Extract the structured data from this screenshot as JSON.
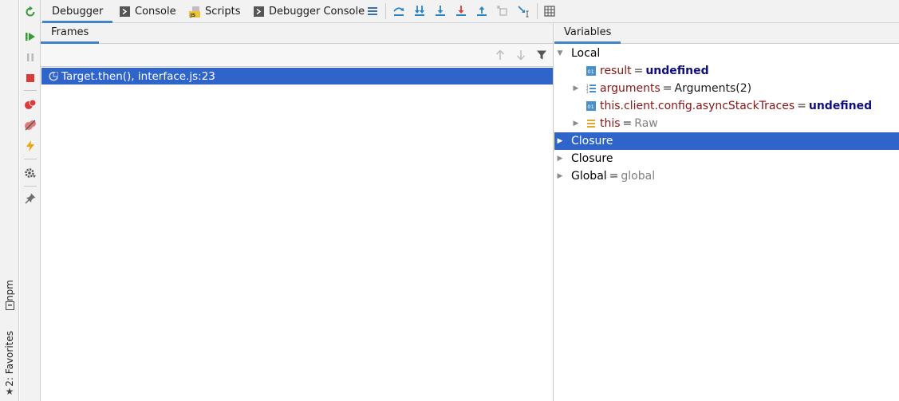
{
  "toolbar": {
    "tabs": [
      {
        "label": "Debugger",
        "active": true
      },
      {
        "label": "Console",
        "icon": "console-icon"
      },
      {
        "label": "Scripts",
        "icon": "js-script-icon"
      },
      {
        "label": "Debugger Console",
        "icon": "console-icon"
      }
    ],
    "action_icons": [
      "layout-menu-icon",
      "step-over-icon",
      "force-step-into-icon",
      "step-into-icon",
      "force-step-into-red-icon",
      "step-out-icon",
      "drop-frame-icon",
      "run-to-cursor-icon",
      "evaluate-expression-icon"
    ]
  },
  "left_actions": [
    "rerun-icon",
    "resume-icon",
    "pause-icon",
    "stop-icon",
    "view-breakpoints-icon",
    "mute-breakpoints-icon",
    "lightning-icon",
    "settings-icon",
    "pin-icon"
  ],
  "side_stripe": {
    "npm_label": "npm",
    "favorites_label": "2: Favorites"
  },
  "frames": {
    "title": "Frames",
    "items": [
      {
        "label": "Target.then(), interface.js:23",
        "selected": true
      }
    ]
  },
  "variables": {
    "title": "Variables",
    "local_label": "Local",
    "items": [
      {
        "name": "result",
        "eq": "=",
        "value": "undefined",
        "icon": "primitive-icon"
      },
      {
        "name": "arguments",
        "eq": "=",
        "value": "Arguments(2)",
        "icon": "array-icon"
      },
      {
        "name": "this.client.config.asyncStackTraces",
        "eq": "=",
        "value": "undefined",
        "icon": "primitive-icon"
      },
      {
        "name": "this",
        "eq": "=",
        "value": "Raw",
        "icon": "object-icon"
      }
    ],
    "scopes": [
      {
        "label": "Closure",
        "selected": true
      },
      {
        "label": "Closure"
      },
      {
        "label": "Global",
        "eq": "=",
        "value": "global"
      }
    ]
  },
  "colors": {
    "selection": "#2f65ca",
    "accent": "#4083c9",
    "var_name": "#8b1313",
    "keyword": "#0d0d80"
  }
}
